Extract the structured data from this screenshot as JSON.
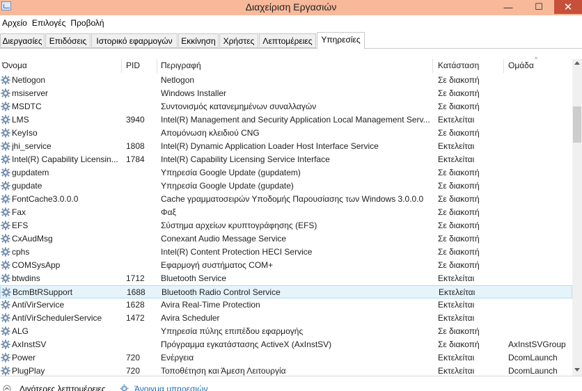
{
  "window": {
    "title": "Διαχείριση Εργασιών",
    "minimize": "—",
    "maximize": "☐",
    "close": "✕"
  },
  "menu": [
    "Αρχείο",
    "Επιλογές",
    "Προβολή"
  ],
  "tabs": [
    "Διεργασίες",
    "Επιδόσεις",
    "Ιστορικό εφαρμογών",
    "Εκκίνηση",
    "Χρήστες",
    "Λεπτομέρειες",
    "Υπηρεσίες"
  ],
  "active_tab": "Υπηρεσίες",
  "columns": [
    "Όνομα",
    "PID",
    "Περιγραφή",
    "Κατάσταση",
    "Ομάδα"
  ],
  "services": [
    {
      "name": "Netlogon",
      "pid": "",
      "desc": "Netlogon",
      "status": "Σε διακοπή",
      "group": ""
    },
    {
      "name": "msiserver",
      "pid": "",
      "desc": "Windows Installer",
      "status": "Σε διακοπή",
      "group": ""
    },
    {
      "name": "MSDTC",
      "pid": "",
      "desc": "Συντονισμός κατανεμημένων συναλλαγών",
      "status": "Σε διακοπή",
      "group": ""
    },
    {
      "name": "LMS",
      "pid": "3940",
      "desc": "Intel(R) Management and Security Application Local Management Serv...",
      "status": "Εκτελείται",
      "group": ""
    },
    {
      "name": "KeyIso",
      "pid": "",
      "desc": "Απομόνωση κλειδιού CNG",
      "status": "Σε διακοπή",
      "group": ""
    },
    {
      "name": "jhi_service",
      "pid": "1808",
      "desc": "Intel(R) Dynamic Application Loader Host Interface Service",
      "status": "Εκτελείται",
      "group": ""
    },
    {
      "name": "Intel(R) Capability Licensin...",
      "pid": "1784",
      "desc": "Intel(R) Capability Licensing Service Interface",
      "status": "Εκτελείται",
      "group": ""
    },
    {
      "name": "gupdatem",
      "pid": "",
      "desc": "Υπηρεσία Google Update (gupdatem)",
      "status": "Σε διακοπή",
      "group": ""
    },
    {
      "name": "gupdate",
      "pid": "",
      "desc": "Υπηρεσία Google Update (gupdate)",
      "status": "Σε διακοπή",
      "group": ""
    },
    {
      "name": "FontCache3.0.0.0",
      "pid": "",
      "desc": "Cache γραμματοσειρών Υποδομής Παρουσίασης των Windows 3.0.0.0",
      "status": "Σε διακοπή",
      "group": ""
    },
    {
      "name": "Fax",
      "pid": "",
      "desc": "Φαξ",
      "status": "Σε διακοπή",
      "group": ""
    },
    {
      "name": "EFS",
      "pid": "",
      "desc": "Σύστημα αρχείων κρυπτογράφησης (EFS)",
      "status": "Σε διακοπή",
      "group": ""
    },
    {
      "name": "CxAudMsg",
      "pid": "",
      "desc": "Conexant Audio Message Service",
      "status": "Σε διακοπή",
      "group": ""
    },
    {
      "name": "cphs",
      "pid": "",
      "desc": "Intel(R) Content Protection HECI Service",
      "status": "Σε διακοπή",
      "group": ""
    },
    {
      "name": "COMSysApp",
      "pid": "",
      "desc": "Εφαρμογή συστήματος COM+",
      "status": "Σε διακοπή",
      "group": ""
    },
    {
      "name": "btwdins",
      "pid": "1712",
      "desc": "Bluetooth Service",
      "status": "Εκτελείται",
      "group": ""
    },
    {
      "name": "BcmBtRSupport",
      "pid": "1688",
      "desc": "Bluetooth Radio Control Service",
      "status": "Εκτελείται",
      "group": ""
    },
    {
      "name": "AntiVirService",
      "pid": "1628",
      "desc": "Avira Real-Time Protection",
      "status": "Εκτελείται",
      "group": ""
    },
    {
      "name": "AntiVirSchedulerService",
      "pid": "1472",
      "desc": "Avira Scheduler",
      "status": "Εκτελείται",
      "group": ""
    },
    {
      "name": "ALG",
      "pid": "",
      "desc": "Υπηρεσία πύλης επιπέδου εφαρμογής",
      "status": "Σε διακοπή",
      "group": ""
    },
    {
      "name": "AxInstSV",
      "pid": "",
      "desc": "Πρόγραμμα εγκατάστασης ActiveX (AxInstSV)",
      "status": "Σε διακοπή",
      "group": "AxInstSVGroup"
    },
    {
      "name": "Power",
      "pid": "720",
      "desc": "Ενέργεια",
      "status": "Εκτελείται",
      "group": "DcomLaunch"
    },
    {
      "name": "PlugPlay",
      "pid": "720",
      "desc": "Τοποθέτηση και Άμεση Λειτουργία",
      "status": "Εκτελείται",
      "group": "DcomLaunch"
    }
  ],
  "selected_service": "BcmBtRSupport",
  "footer": {
    "fewer_details": "Λιγότερες λεπτομέρειες",
    "open_services": "Άνοιγμα υπηρεσιών"
  }
}
